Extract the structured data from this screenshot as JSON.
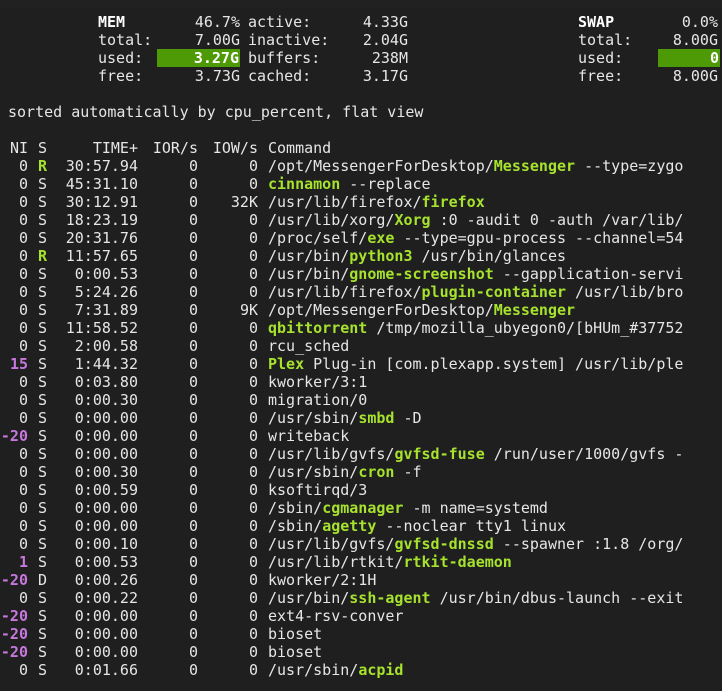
{
  "mem": {
    "label": "MEM",
    "percent": "46.7%",
    "total_label": "total:",
    "total": "7.00G",
    "used_label": "used:",
    "used": "3.27G",
    "free_label": "free:",
    "free": "3.73G",
    "active_label": "active:",
    "active": "4.33G",
    "inactive_label": "inactive:",
    "inactive": "2.04G",
    "buffers_label": "buffers:",
    "buffers": "238M",
    "cached_label": "cached:",
    "cached": "3.17G"
  },
  "swap": {
    "label": "SWAP",
    "percent": "0.0%",
    "total_label": "total:",
    "total": "8.00G",
    "used_label": "used:",
    "used": "0",
    "free_label": "free:",
    "free": "8.00G"
  },
  "sort_message": "sorted automatically by cpu_percent, flat view",
  "columns": {
    "ni": "NI",
    "s": "S",
    "time": "TIME+",
    "ior": "IOR/s",
    "iow": "IOW/s",
    "command": "Command"
  },
  "colors": {
    "highlight": "#a6e22e",
    "used_bar": "#4e9a06",
    "negative_nice": "#c678dd"
  },
  "processes": [
    {
      "ni": "0",
      "s": "R",
      "time": "30:57.94",
      "ior": "0",
      "iow": "0",
      "cmd": [
        [
          "/opt/MessengerForDesktop/",
          false
        ],
        [
          "Messenger",
          true
        ],
        [
          " --type=zygo",
          false
        ]
      ]
    },
    {
      "ni": "0",
      "s": "S",
      "time": "45:31.10",
      "ior": "0",
      "iow": "0",
      "cmd": [
        [
          "cinnamon",
          true
        ],
        [
          " --replace",
          false
        ]
      ]
    },
    {
      "ni": "0",
      "s": "S",
      "time": "30:12.91",
      "ior": "0",
      "iow": "32K",
      "cmd": [
        [
          "/usr/lib/firefox/",
          false
        ],
        [
          "firefox",
          true
        ]
      ]
    },
    {
      "ni": "0",
      "s": "S",
      "time": "18:23.19",
      "ior": "0",
      "iow": "0",
      "cmd": [
        [
          "/usr/lib/xorg/",
          false
        ],
        [
          "Xorg",
          true
        ],
        [
          " :0 -audit 0 -auth /var/lib/",
          false
        ]
      ]
    },
    {
      "ni": "0",
      "s": "S",
      "time": "20:31.76",
      "ior": "0",
      "iow": "0",
      "cmd": [
        [
          "/proc/self/",
          false
        ],
        [
          "exe",
          true
        ],
        [
          " --type=gpu-process --channel=54",
          false
        ]
      ]
    },
    {
      "ni": "0",
      "s": "R",
      "time": "11:57.65",
      "ior": "0",
      "iow": "0",
      "cmd": [
        [
          "/usr/bin/",
          false
        ],
        [
          "python3",
          true
        ],
        [
          " /usr/bin/glances",
          false
        ]
      ]
    },
    {
      "ni": "0",
      "s": "S",
      "time": "0:00.53",
      "ior": "0",
      "iow": "0",
      "cmd": [
        [
          "/usr/bin/",
          false
        ],
        [
          "gnome-screenshot",
          true
        ],
        [
          " --gapplication-servi",
          false
        ]
      ]
    },
    {
      "ni": "0",
      "s": "S",
      "time": "5:24.26",
      "ior": "0",
      "iow": "0",
      "cmd": [
        [
          "/usr/lib/firefox/",
          false
        ],
        [
          "plugin-container",
          true
        ],
        [
          " /usr/lib/bro",
          false
        ]
      ]
    },
    {
      "ni": "0",
      "s": "S",
      "time": "7:31.89",
      "ior": "0",
      "iow": "9K",
      "cmd": [
        [
          "/opt/MessengerForDesktop/",
          false
        ],
        [
          "Messenger",
          true
        ]
      ]
    },
    {
      "ni": "0",
      "s": "S",
      "time": "11:58.52",
      "ior": "0",
      "iow": "0",
      "cmd": [
        [
          "qbittorrent",
          true
        ],
        [
          " /tmp/mozilla_ubyegon0/[bHUm_#37752",
          false
        ]
      ]
    },
    {
      "ni": "0",
      "s": "S",
      "time": "2:00.58",
      "ior": "0",
      "iow": "0",
      "cmd": [
        [
          "rcu_sched",
          false
        ]
      ]
    },
    {
      "ni": "15",
      "s": "S",
      "time": "1:44.32",
      "ior": "0",
      "iow": "0",
      "cmd": [
        [
          "Plex",
          true
        ],
        [
          " Plug-in [com.plexapp.system] /usr/lib/ple",
          false
        ]
      ]
    },
    {
      "ni": "0",
      "s": "S",
      "time": "0:03.80",
      "ior": "0",
      "iow": "0",
      "cmd": [
        [
          "kworker/3:1",
          false
        ]
      ]
    },
    {
      "ni": "0",
      "s": "S",
      "time": "0:00.30",
      "ior": "0",
      "iow": "0",
      "cmd": [
        [
          "migration/0",
          false
        ]
      ]
    },
    {
      "ni": "0",
      "s": "S",
      "time": "0:00.00",
      "ior": "0",
      "iow": "0",
      "cmd": [
        [
          "/usr/sbin/",
          false
        ],
        [
          "smbd",
          true
        ],
        [
          " -D",
          false
        ]
      ]
    },
    {
      "ni": "-20",
      "s": "S",
      "time": "0:00.00",
      "ior": "0",
      "iow": "0",
      "cmd": [
        [
          "writeback",
          false
        ]
      ]
    },
    {
      "ni": "0",
      "s": "S",
      "time": "0:00.00",
      "ior": "0",
      "iow": "0",
      "cmd": [
        [
          "/usr/lib/gvfs/",
          false
        ],
        [
          "gvfsd-fuse",
          true
        ],
        [
          " /run/user/1000/gvfs -",
          false
        ]
      ]
    },
    {
      "ni": "0",
      "s": "S",
      "time": "0:00.30",
      "ior": "0",
      "iow": "0",
      "cmd": [
        [
          "/usr/sbin/",
          false
        ],
        [
          "cron",
          true
        ],
        [
          " -f",
          false
        ]
      ]
    },
    {
      "ni": "0",
      "s": "S",
      "time": "0:00.59",
      "ior": "0",
      "iow": "0",
      "cmd": [
        [
          "ksoftirqd/3",
          false
        ]
      ]
    },
    {
      "ni": "0",
      "s": "S",
      "time": "0:00.00",
      "ior": "0",
      "iow": "0",
      "cmd": [
        [
          "/sbin/",
          false
        ],
        [
          "cgmanager",
          true
        ],
        [
          " -m name=systemd",
          false
        ]
      ]
    },
    {
      "ni": "0",
      "s": "S",
      "time": "0:00.00",
      "ior": "0",
      "iow": "0",
      "cmd": [
        [
          "/sbin/",
          false
        ],
        [
          "agetty",
          true
        ],
        [
          " --noclear tty1 linux",
          false
        ]
      ]
    },
    {
      "ni": "0",
      "s": "S",
      "time": "0:00.10",
      "ior": "0",
      "iow": "0",
      "cmd": [
        [
          "/usr/lib/gvfs/",
          false
        ],
        [
          "gvfsd-dnssd",
          true
        ],
        [
          " --spawner :1.8 /org/",
          false
        ]
      ]
    },
    {
      "ni": "1",
      "s": "S",
      "time": "0:00.53",
      "ior": "0",
      "iow": "0",
      "cmd": [
        [
          "/usr/lib/rtkit/",
          false
        ],
        [
          "rtkit-daemon",
          true
        ]
      ]
    },
    {
      "ni": "-20",
      "s": "D",
      "time": "0:00.26",
      "ior": "0",
      "iow": "0",
      "cmd": [
        [
          "kworker/2:1H",
          false
        ]
      ]
    },
    {
      "ni": "0",
      "s": "S",
      "time": "0:00.22",
      "ior": "0",
      "iow": "0",
      "cmd": [
        [
          "/usr/bin/",
          false
        ],
        [
          "ssh-agent",
          true
        ],
        [
          " /usr/bin/dbus-launch --exit",
          false
        ]
      ]
    },
    {
      "ni": "-20",
      "s": "S",
      "time": "0:00.00",
      "ior": "0",
      "iow": "0",
      "cmd": [
        [
          "ext4-rsv-conver",
          false
        ]
      ]
    },
    {
      "ni": "-20",
      "s": "S",
      "time": "0:00.00",
      "ior": "0",
      "iow": "0",
      "cmd": [
        [
          "bioset",
          false
        ]
      ]
    },
    {
      "ni": "-20",
      "s": "S",
      "time": "0:00.00",
      "ior": "0",
      "iow": "0",
      "cmd": [
        [
          "bioset",
          false
        ]
      ]
    },
    {
      "ni": "0",
      "s": "S",
      "time": "0:01.66",
      "ior": "0",
      "iow": "0",
      "cmd": [
        [
          "/usr/sbin/",
          false
        ],
        [
          "acpid",
          true
        ]
      ]
    }
  ]
}
